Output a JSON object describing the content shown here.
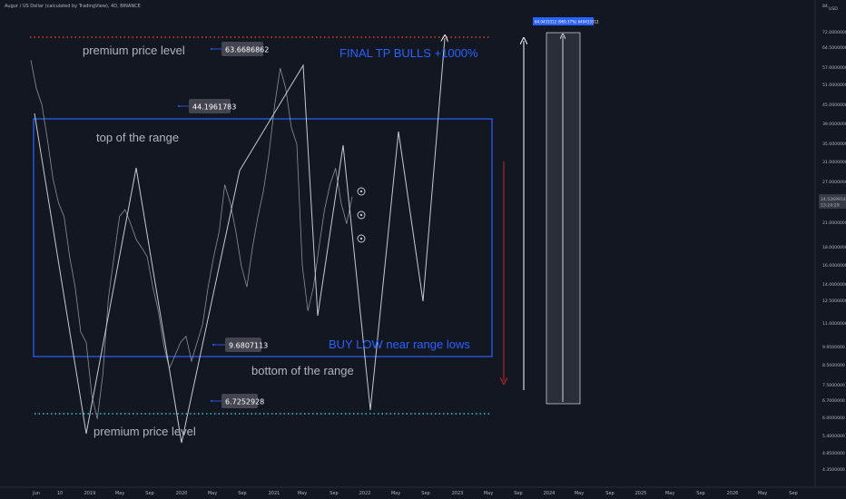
{
  "header": {
    "title": "Augur / US Dollar (calculated by TradingView), 4D, BINANCE"
  },
  "axis": {
    "currency": "USD",
    "y_ticks": [
      "84.",
      "72.0000000",
      "64.5000000",
      "57.0000000",
      "51.0000000",
      "45.0000000",
      "39.0000000",
      "35.0000000",
      "31.0000000",
      "27.0000000",
      "24.0000000",
      "21.0000000",
      "18.0000000",
      "16.0000000",
      "14.0000000",
      "12.5000000",
      "11.0000000",
      "9.9500000",
      "8.5000000",
      "7.5000000",
      "6.7000000",
      "6.0000000",
      "5.4000000",
      "4.8500000",
      "4.3500000"
    ],
    "x_ticks": [
      "Jun",
      "10",
      "2019",
      "May",
      "Sep",
      "2020",
      "May",
      "Sep",
      "2021",
      "May",
      "Sep",
      "2022",
      "May",
      "Sep",
      "2023",
      "May",
      "Sep",
      "2024",
      "May",
      "Sep",
      "2025",
      "May",
      "Sep",
      "2026",
      "May",
      "Sep"
    ]
  },
  "current_price": {
    "value": "24.5269914",
    "countdown": "13:24:29"
  },
  "projection_label": "64.0433312 (969.37%) 640433312",
  "levels": [
    {
      "value": "63.6686862"
    },
    {
      "value": "44.1961783"
    },
    {
      "value": "9.6807113"
    },
    {
      "value": "6.7252928"
    }
  ],
  "annotations": {
    "premium_top": "premium price level",
    "premium_bottom": "premium price level",
    "top_range": "top of the range",
    "bottom_range": "bottom of the range",
    "final_tp": "FINAL TP BULLS +1000%",
    "buy_low": "BUY LOW near range lows"
  },
  "colors": {
    "background": "#131722",
    "price_line": "#8a8f9b",
    "range_box": "#2962ff",
    "annotation_blue": "#2962ff",
    "red_dotted": "#e53935",
    "cyan_dotted": "#26c6da",
    "red_arrow": "#c62828",
    "projection_fill": "#2a2e39"
  },
  "chart_data": {
    "type": "line",
    "title": "",
    "levels_usd": [
      63.6686862,
      44.1961783,
      9.6807113,
      6.7252928
    ],
    "range_box_usd": [
      8.9,
      44.2
    ],
    "projection_path_usd": [
      39,
      9.9,
      31,
      6.0,
      29,
      5.3,
      28,
      36,
      13.7,
      63,
      10.5,
      28,
      5.9,
      38,
      12.5,
      72
    ],
    "price_series_usd": [
      60,
      50,
      45,
      36,
      28,
      24,
      22,
      17,
      14,
      10.5,
      9.8,
      7.0,
      6.0,
      8.0,
      13,
      17,
      22,
      23,
      21,
      19,
      18,
      17,
      14,
      12,
      9.6,
      8.3,
      9.0,
      9.8,
      10.2,
      8.7,
      9.8,
      11,
      14,
      17,
      20,
      27,
      24,
      20,
      16,
      14,
      18,
      22,
      26,
      33,
      45,
      57,
      50,
      39,
      35,
      16,
      12,
      14,
      18,
      23,
      27,
      30,
      24,
      21,
      25
    ]
  }
}
